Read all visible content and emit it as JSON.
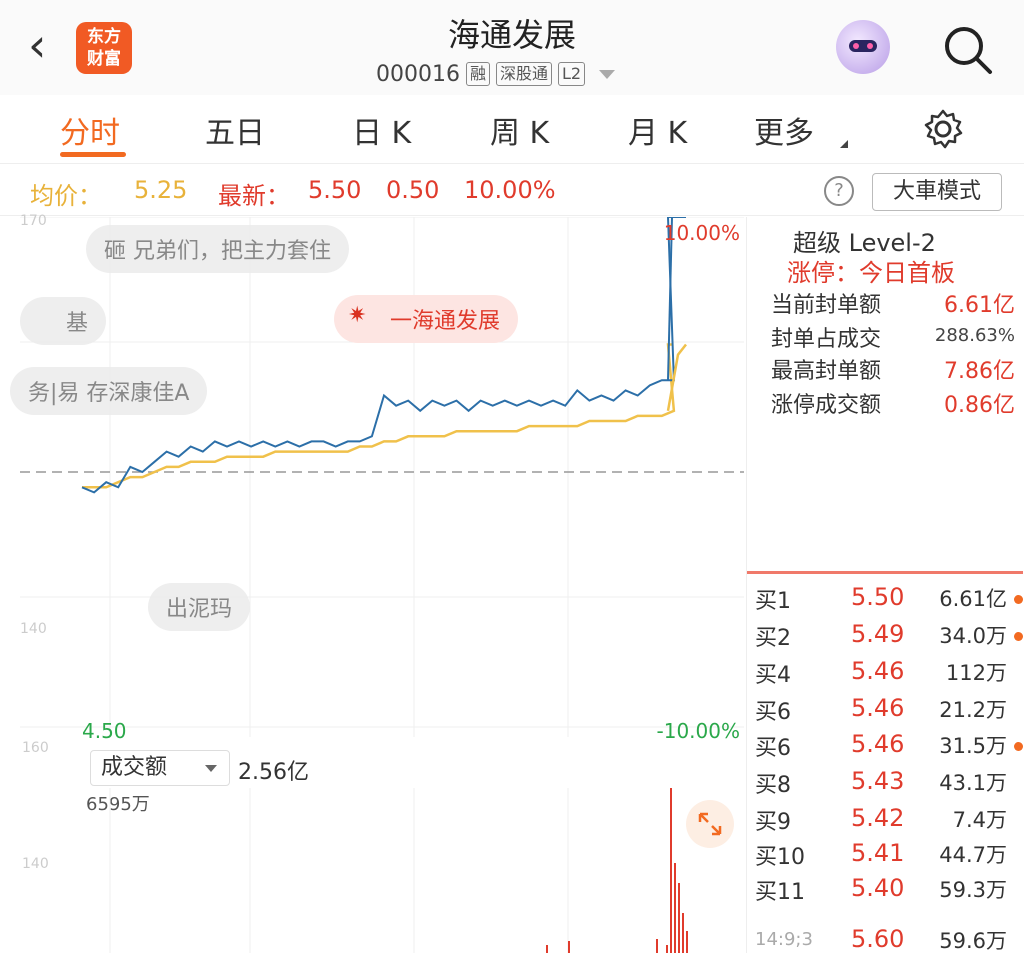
{
  "header": {
    "back_icon": "chevron-left-icon",
    "logo_text_top": "东方",
    "logo_text_bottom": "财富",
    "title": "海通发展",
    "code": "000016",
    "tags": [
      "融",
      "深股通",
      "L2"
    ]
  },
  "tabs": [
    "分时",
    "五日",
    "日 K",
    "周 K",
    "月 K",
    "更多"
  ],
  "active_tab": "分时",
  "info": {
    "avg_label": "均价：",
    "avg_value": "5.25",
    "latest_label": "最新：",
    "latest_price": "5.50",
    "change": "0.50",
    "change_pct": "10.00%",
    "big_mode": "大車模式",
    "help": "?"
  },
  "chart": {
    "top_pct": "10.00%",
    "bottom_pct": "-10.00%",
    "bottom_price": "4.50",
    "faint_top": "170",
    "faint_mid": "140",
    "faint_low": "160",
    "faint_low2": "140"
  },
  "bubbles": {
    "b1": "砸 兄弟们，把主力套住",
    "b2": "基",
    "b3": "一海通发展",
    "b4": "务|易 存深康佳A",
    "b5": "出泥玛"
  },
  "volume": {
    "selector": "成交额",
    "total": "2.56亿",
    "max_label": "6595万"
  },
  "right_panel": {
    "title": "超级 Level-2",
    "limit_status": "涨停：今日首板",
    "stats": [
      {
        "k": "当前封单额",
        "v": "6.61亿"
      },
      {
        "k": "封单占成交",
        "v": "288.63%"
      },
      {
        "k": "最高封单额",
        "v": "7.86亿"
      },
      {
        "k": "涨停成交额",
        "v": "0.86亿"
      }
    ],
    "orderbook": [
      {
        "label": "买1",
        "price": "5.50",
        "vol": "6.61亿",
        "dot": true
      },
      {
        "label": "买2",
        "price": "5.49",
        "vol": "34.0万",
        "dot": true
      },
      {
        "label": "买4",
        "price": "5.46",
        "vol": "112万",
        "dot": false
      },
      {
        "label": "买6",
        "price": "5.46",
        "vol": "21.2万",
        "dot": false
      },
      {
        "label": "买6",
        "price": "5.46",
        "vol": "31.5万",
        "dot": true
      },
      {
        "label": "买8",
        "price": "5.43",
        "vol": "43.1万",
        "dot": false
      },
      {
        "label": "买9",
        "price": "5.42",
        "vol": "7.4万",
        "dot": false
      },
      {
        "label": "买10",
        "price": "5.41",
        "vol": "44.7万",
        "dot": false
      },
      {
        "label": "买11",
        "price": "5.40",
        "vol": "59.3万",
        "dot": false
      },
      {
        "label": "14:9;3",
        "price": "5.60",
        "vol": "59.6万",
        "dot": false
      }
    ]
  },
  "colors": {
    "accent": "#f26a21",
    "up": "#e03b2c",
    "down": "#2aa84a",
    "price_line": "#2c6fa8",
    "avg_line": "#f0c14b"
  },
  "chart_data": {
    "type": "line",
    "yaxis": {
      "min": 4.5,
      "max": 5.5,
      "prev_close": 5.0
    },
    "series": [
      {
        "values": [
          4.97,
          4.96,
          4.98,
          4.97,
          5.01,
          5.0,
          5.02,
          5.04,
          5.03,
          5.05,
          5.04,
          5.06,
          5.05,
          5.06,
          5.05,
          5.06,
          5.05,
          5.06,
          5.05,
          5.06,
          5.06,
          5.05,
          5.06,
          5.06,
          5.07,
          5.15,
          5.13,
          5.14,
          5.12,
          5.14,
          5.13,
          5.14,
          5.12,
          5.14,
          5.13,
          5.14,
          5.13,
          5.14,
          5.13,
          5.14,
          5.13,
          5.16,
          5.14,
          5.15,
          5.14,
          5.16,
          5.15,
          5.17,
          5.18,
          5.18,
          5.5,
          5.5
        ]
      },
      {
        "values": [
          4.97,
          4.97,
          4.97,
          4.98,
          4.99,
          4.99,
          5.0,
          5.01,
          5.01,
          5.02,
          5.02,
          5.02,
          5.03,
          5.03,
          5.03,
          5.03,
          5.04,
          5.04,
          5.04,
          5.04,
          5.04,
          5.04,
          5.04,
          5.05,
          5.05,
          5.06,
          5.06,
          5.07,
          5.07,
          5.07,
          5.07,
          5.08,
          5.08,
          5.08,
          5.08,
          5.08,
          5.08,
          5.09,
          5.09,
          5.09,
          5.09,
          5.09,
          5.1,
          5.1,
          5.1,
          5.1,
          5.11,
          5.11,
          5.11,
          5.12,
          5.25,
          5.25
        ]
      }
    ]
  }
}
